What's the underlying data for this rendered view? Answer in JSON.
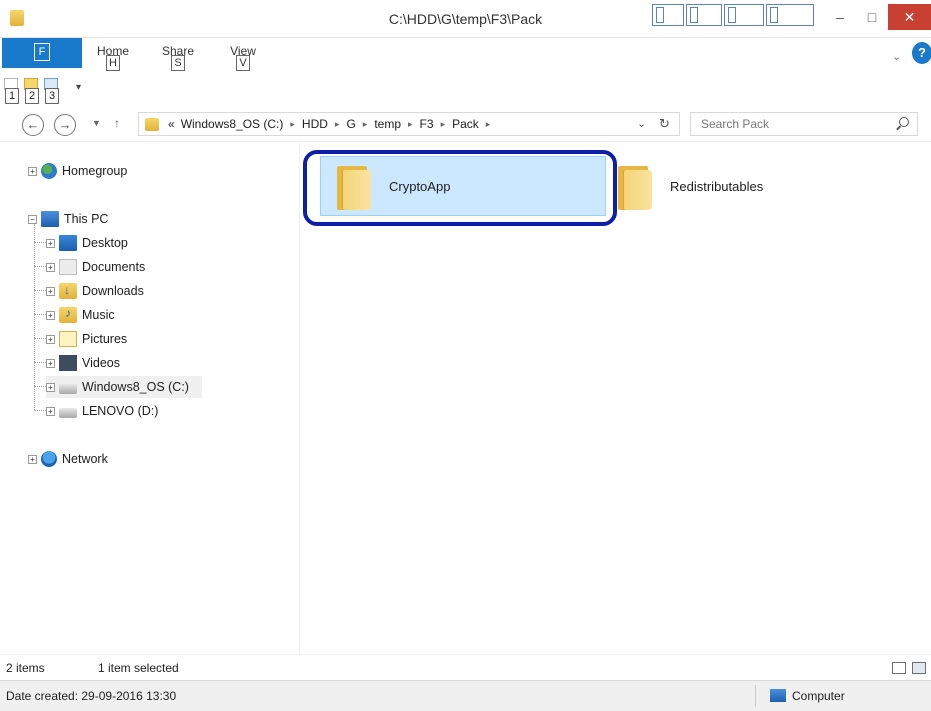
{
  "window": {
    "title": "C:\\HDD\\G\\temp\\F3\\Pack",
    "buttons": {
      "minimize": "–",
      "maximize": "□",
      "close": "✕"
    }
  },
  "ribbon": {
    "file_key": "F",
    "tabs": [
      {
        "label": "Home",
        "key": "H"
      },
      {
        "label": "Share",
        "key": "S"
      },
      {
        "label": "View",
        "key": "V"
      }
    ],
    "quick_access_keys": [
      "1",
      "2",
      "3"
    ],
    "help": "?"
  },
  "address": {
    "overflow": "«",
    "crumbs": [
      "Windows8_OS (C:)",
      "HDD",
      "G",
      "temp",
      "F3",
      "Pack"
    ],
    "separator": "▸"
  },
  "search": {
    "placeholder": "Search Pack"
  },
  "navpane": {
    "homegroup": "Homegroup",
    "this_pc": "This PC",
    "pc_items": [
      "Desktop",
      "Documents",
      "Downloads",
      "Music",
      "Pictures",
      "Videos",
      "Windows8_OS (C:)",
      "LENOVO (D:)"
    ],
    "network": "Network"
  },
  "content": {
    "items": [
      {
        "name": "CryptoApp",
        "selected": true
      },
      {
        "name": "Redistributables",
        "selected": false
      }
    ]
  },
  "status": {
    "item_count": "2 items",
    "selection": "1 item selected"
  },
  "details": {
    "date_created": "Date created: 29-09-2016 13:30",
    "location": "Computer"
  },
  "colors": {
    "accent": "#1979ca",
    "selection_bg": "#cce8ff",
    "highlight_ring": "#0b1fa8",
    "close_button": "#c84031"
  }
}
